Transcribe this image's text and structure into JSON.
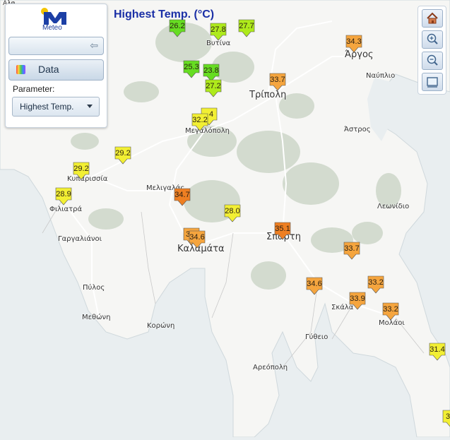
{
  "title": "Highest Temp. (°C)",
  "panel": {
    "logo_text": "Meteo",
    "data_label": "Data",
    "parameter_label": "Parameter:",
    "parameter_value": "Highest Temp."
  },
  "tools": [
    {
      "name": "home",
      "icon": "home-icon"
    },
    {
      "name": "zoom-in",
      "icon": "zoom-in-icon"
    },
    {
      "name": "zoom-out",
      "icon": "zoom-out-icon"
    },
    {
      "name": "extent",
      "icon": "extent-icon"
    }
  ],
  "colors": {
    "sea": "#e9eef0",
    "land": "#f6f6f4",
    "forest": "#d3dbcf",
    "road": "#ffffff",
    "title": "#1a2fa6",
    "marker_green": "#66dd22",
    "marker_lime": "#aeea1b",
    "marker_yellow": "#f2ef33",
    "marker_orange": "#f5a53e",
    "marker_darkorange": "#ee7f22"
  },
  "stations": [
    {
      "value": "26.2",
      "color": "marker_green"
    },
    {
      "value": "27.8",
      "color": "marker_lime"
    },
    {
      "value": "27.7",
      "color": "marker_lime"
    },
    {
      "value": "25.3",
      "color": "marker_green"
    },
    {
      "value": "23.8",
      "color": "marker_green"
    },
    {
      "value": "27.2",
      "color": "marker_lime"
    },
    {
      "value": "34.3",
      "color": "marker_orange"
    },
    {
      "value": "33.7",
      "color": "marker_orange"
    },
    {
      "value": "4",
      "color": "marker_yellow"
    },
    {
      "value": "32.2",
      "color": "marker_yellow"
    },
    {
      "value": "29.2",
      "color": "marker_yellow"
    },
    {
      "value": "29.2",
      "color": "marker_yellow"
    },
    {
      "value": "28.9",
      "color": "marker_yellow"
    },
    {
      "value": "34.7",
      "color": "marker_darkorange"
    },
    {
      "value": "28.0",
      "color": "marker_yellow"
    },
    {
      "value": "3",
      "color": "marker_orange"
    },
    {
      "value": "34.6",
      "color": "marker_orange"
    },
    {
      "value": "35.1",
      "color": "marker_darkorange"
    },
    {
      "value": "33.7",
      "color": "marker_orange"
    },
    {
      "value": "34.6",
      "color": "marker_orange"
    },
    {
      "value": "33.2",
      "color": "marker_orange"
    },
    {
      "value": "33.9",
      "color": "marker_orange"
    },
    {
      "value": "33.2",
      "color": "marker_orange"
    },
    {
      "value": "31.4",
      "color": "marker_yellow"
    },
    {
      "value": "3",
      "color": "marker_yellow"
    }
  ],
  "places": [
    {
      "name": "Βυτίνα"
    },
    {
      "name": "Άργος"
    },
    {
      "name": "Ναύπλιο"
    },
    {
      "name": "Τρίπολη"
    },
    {
      "name": "Άστρος"
    },
    {
      "name": "Μεγαλόπολη"
    },
    {
      "name": "Κυπαρισσία"
    },
    {
      "name": "Μελιγαλάς"
    },
    {
      "name": "Φιλιατρά"
    },
    {
      "name": "Λεωνίδιο"
    },
    {
      "name": "Γαργαλιάνοι"
    },
    {
      "name": "Καλαμάτα"
    },
    {
      "name": "Σπάρτη"
    },
    {
      "name": "Πύλος"
    },
    {
      "name": "Σκάλα"
    },
    {
      "name": "Μεθώνη"
    },
    {
      "name": "Κορώνη"
    },
    {
      "name": "Μολάοι"
    },
    {
      "name": "Γύθειο"
    },
    {
      "name": "Αρεόπολη"
    },
    {
      "name": "Αλφ"
    }
  ]
}
